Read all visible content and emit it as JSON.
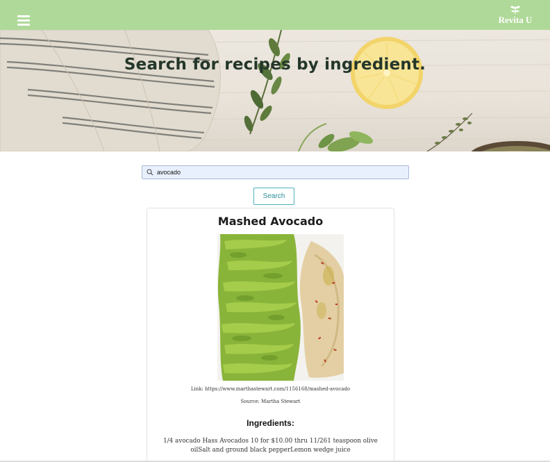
{
  "header": {
    "menu_icon": "hamburger-menu-icon",
    "logo_text": "Revita U",
    "logo_icon": "leaf-sprout-icon",
    "bar_color": "#afd998"
  },
  "hero": {
    "title": "Search for recipes by ingredient."
  },
  "search": {
    "icon": "search-icon",
    "value": "avocado",
    "button_label": "Search",
    "accent_color": "#4fb1bd"
  },
  "recipe": {
    "title": "Mashed Avocado",
    "link_text": "Link: https://www.marthastewart.com/1156168/mashed-avocado",
    "source_text": "Source: Martha Stewart",
    "ingredients_heading": "Ingredients:",
    "ingredients_text": "1/4 avocado Hass Avocados 10 for $10.00 thru 11/261 teaspoon olive oilSalt and ground black pepperLemon wedge juice"
  }
}
